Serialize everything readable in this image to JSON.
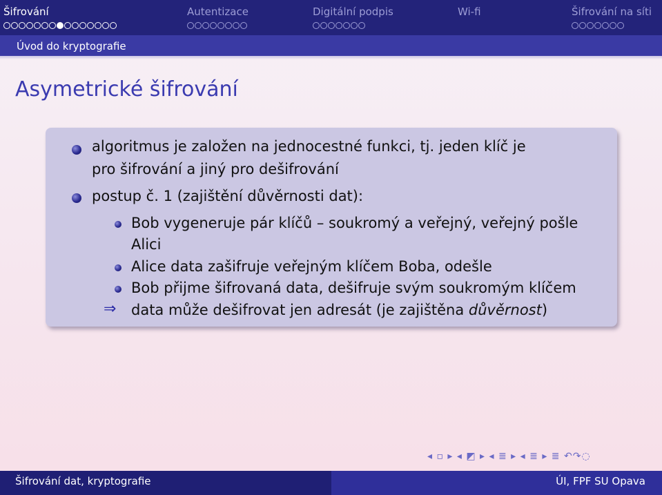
{
  "nav": {
    "sections": [
      {
        "label": "Šifrování",
        "dots": 15,
        "active_dot": 7,
        "current": true
      },
      {
        "label": "Autentizace",
        "dots": 8,
        "active_dot": -1,
        "current": false
      },
      {
        "label": "Digitální podpis",
        "dots": 7,
        "active_dot": -1,
        "current": false
      },
      {
        "label": "Wi-fi",
        "dots": 0,
        "active_dot": -1,
        "current": false
      },
      {
        "label": "Šifrování na síti",
        "dots": 7,
        "active_dot": -1,
        "current": false
      }
    ],
    "subsection": "Úvod do kryptografie"
  },
  "slide": {
    "title": "Asymetrické šifrování",
    "bullets": [
      {
        "line1": "algoritmus je založen na jednocestné funkci, tj. jeden klíč je",
        "line2": "pro šifrování a jiný pro dešifrování"
      },
      {
        "line1": "postup č. 1 (zajištění důvěrnosti dat):"
      }
    ],
    "subbullets": [
      {
        "line1": "Bob vygeneruje pár klíčů – soukromý a veřejný, veřejný pošle",
        "line2": "Alici"
      },
      {
        "line1": "Alice data zašifruje veřejným klíčem Boba, odešle"
      },
      {
        "line1": "Bob přijme šifrovaná data, dešifruje svým soukromým klíčem"
      }
    ],
    "conclusion_prefix": "data může dešifrovat jen adresát (je zajištěna ",
    "conclusion_emph": "důvěrnost",
    "conclusion_suffix": ")"
  },
  "navigation_symbols": "◂ ▫ ▸ ◂ ◩ ▸ ◂ ≣ ▸ ◂ ≣ ▸ ≣ ↶↷◌",
  "footer": {
    "left": "Šifrování dat, kryptografie",
    "right": "ÚI, FPF SU Opava"
  }
}
